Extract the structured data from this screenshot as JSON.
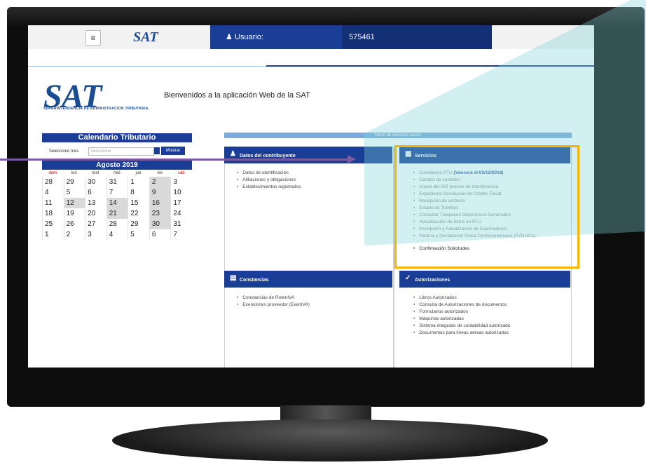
{
  "topbar": {
    "menu_icon": "hamburger-icon",
    "logo": "SAT",
    "user_label": "Usuario:",
    "user_value": "575461"
  },
  "brand": {
    "logo": "SAT",
    "subtitle": "SUPERINTENDENCIA DE ADMINISTRACION TRIBUTARIA",
    "welcome": "Bienvenidos a la aplicación Web de la SAT"
  },
  "calendar": {
    "title": "Calendario Tributario",
    "select_label": "Seleccione mes",
    "select_placeholder": "Seleccione",
    "button": "Mostrar",
    "month": "Agosto 2019",
    "days": [
      "dom",
      "lun",
      "mar",
      "mié",
      "jue",
      "vie",
      "sáb"
    ],
    "weeks": [
      [
        "28",
        "29",
        "30",
        "31",
        "1",
        "2",
        "3"
      ],
      [
        "4",
        "5",
        "6",
        "7",
        "8",
        "9",
        "10"
      ],
      [
        "11",
        "12",
        "13",
        "14",
        "15",
        "16",
        "17"
      ],
      [
        "18",
        "19",
        "20",
        "21",
        "22",
        "23",
        "24"
      ],
      [
        "25",
        "26",
        "27",
        "28",
        "29",
        "30",
        "31"
      ],
      [
        "1",
        "2",
        "3",
        "4",
        "5",
        "6",
        "7"
      ]
    ]
  },
  "menu": {
    "title": "Menú de servicios varios",
    "datos": {
      "title": "Datos del contribuyente",
      "items": [
        "Datos de identificación",
        "Afiliaciones y obligaciones",
        "Establecimientos registrados"
      ]
    },
    "servicios": {
      "title": "Servicios",
      "first_item": "Constancia RTU",
      "first_note": "(Vencerá el 03/12/2019)",
      "items": [
        "Cambio de contador",
        "Anexo del ISR precios de transferencia",
        "Expediente Devolución de Crédito Fiscal",
        "Recepción de archivos",
        "Estado de Trámites",
        "Consultar Traspasos Electrónicos Generados",
        "Actualización de datos en RTU",
        "Inscripción y Actualización de Exportadores",
        "Factura y Declaración Única Centroamericana (FYDUCA)"
      ],
      "last_item": "Confirmación Solicitudes"
    },
    "constancias": {
      "title": "Constancias",
      "items": [
        "Constancias de RetenIVA",
        "Exenciones proveedor (ExenIVA)"
      ]
    },
    "autorizaciones": {
      "title": "Autorizaciones",
      "items": [
        "Libros Autorizados",
        "Consulta de Autorizaciones de documentos",
        "Formularios autorizados",
        "Máquinas autorizadas",
        "Sistema integrado de contabilidad autorizado",
        "Documentos para líneas aéreas autorizados"
      ]
    }
  }
}
